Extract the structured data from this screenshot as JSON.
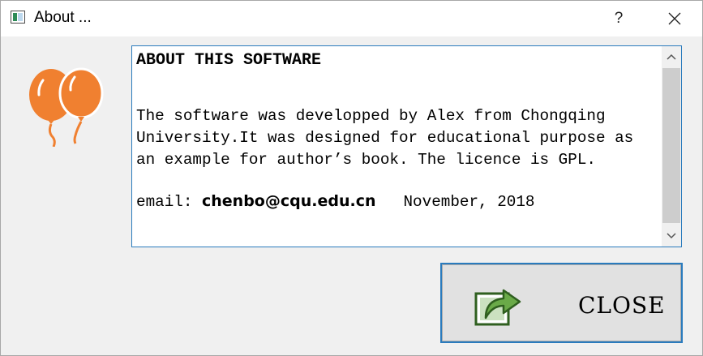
{
  "window": {
    "title": "About ...",
    "help_label": "?",
    "icons": {
      "app": "app-window-icon",
      "close": "close-icon"
    }
  },
  "logo": {
    "icon": "balloons-icon",
    "color": "#f08030"
  },
  "about": {
    "heading": "ABOUT THIS SOFTWARE",
    "lines": [
      "The software was developped by Alex from Chongqing",
      "University.It was designed for educational purpose as",
      "an example for author’s book. The licence is GPL."
    ],
    "email_label": "email: ",
    "email": "chenbo@cqu.edu.cn",
    "date": "November, 2018"
  },
  "actions": {
    "close_label": "CLOSE",
    "close_icon": "export-arrow-icon"
  },
  "colors": {
    "accent": "#2a7bbd",
    "icon_green": "#5a9a3a"
  }
}
